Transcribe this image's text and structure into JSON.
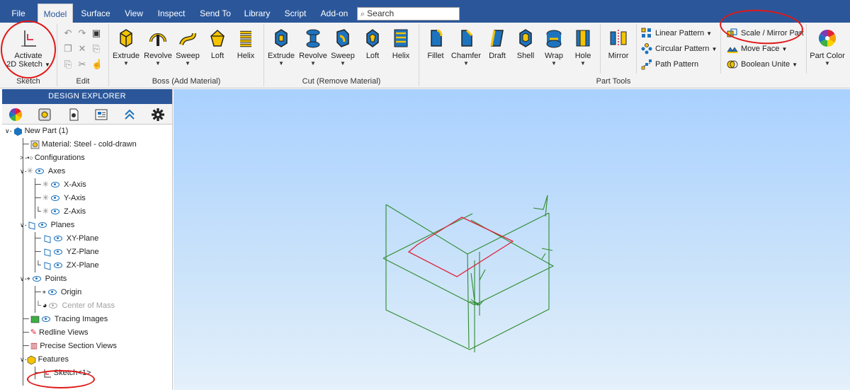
{
  "menu": {
    "tabs": [
      "File",
      "Model",
      "Surface",
      "View",
      "Inspect",
      "Send To",
      "Library",
      "Script",
      "Add-on"
    ],
    "active": "Model",
    "search_placeholder": "Search"
  },
  "ribbon": {
    "groups": {
      "sketch": "Sketch",
      "edit": "Edit",
      "boss": "Boss (Add Material)",
      "cut": "Cut (Remove Material)",
      "parttools": "Part Tools"
    },
    "activate": {
      "line1": "Activate",
      "line2": "2D Sketch"
    },
    "boss": [
      "Extrude",
      "Revolve",
      "Sweep",
      "Loft",
      "Helix"
    ],
    "cut": [
      "Extrude",
      "Revolve",
      "Sweep",
      "Loft",
      "Helix"
    ],
    "tools": [
      "Fillet",
      "Chamfer",
      "Draft",
      "Shell",
      "Wrap",
      "Hole"
    ],
    "mirror": "Mirror",
    "pattern": [
      "Linear Pattern",
      "Circular Pattern",
      "Path Pattern"
    ],
    "modify": [
      "Scale / Mirror Part",
      "Move Face",
      "Boolean Unite"
    ],
    "partcolor": "Part Color",
    "colors": {
      "menubar": "#2b579a",
      "accent_yellow": "#f5c400",
      "accent_blue": "#1e73be",
      "annotation_red": "#e01818"
    }
  },
  "explorer": {
    "title": "DESIGN EXPLORER",
    "tree": [
      {
        "label": "New Part (1)"
      },
      {
        "label": "Material: Steel - cold-drawn"
      },
      {
        "label": "Configurations"
      },
      {
        "label": "Axes"
      },
      {
        "label": "X-Axis"
      },
      {
        "label": "Y-Axis"
      },
      {
        "label": "Z-Axis"
      },
      {
        "label": "Planes"
      },
      {
        "label": "XY-Plane"
      },
      {
        "label": "YZ-Plane"
      },
      {
        "label": "ZX-Plane"
      },
      {
        "label": "Points"
      },
      {
        "label": "Origin"
      },
      {
        "label": "Center of Mass"
      },
      {
        "label": "Tracing Images"
      },
      {
        "label": "Redline Views"
      },
      {
        "label": "Precise Section Views"
      },
      {
        "label": "Features"
      },
      {
        "label": "Sketch<1>"
      }
    ]
  },
  "viewport": {
    "wire_color": "#2e8b2e",
    "sketch_color": "#e0203a"
  }
}
